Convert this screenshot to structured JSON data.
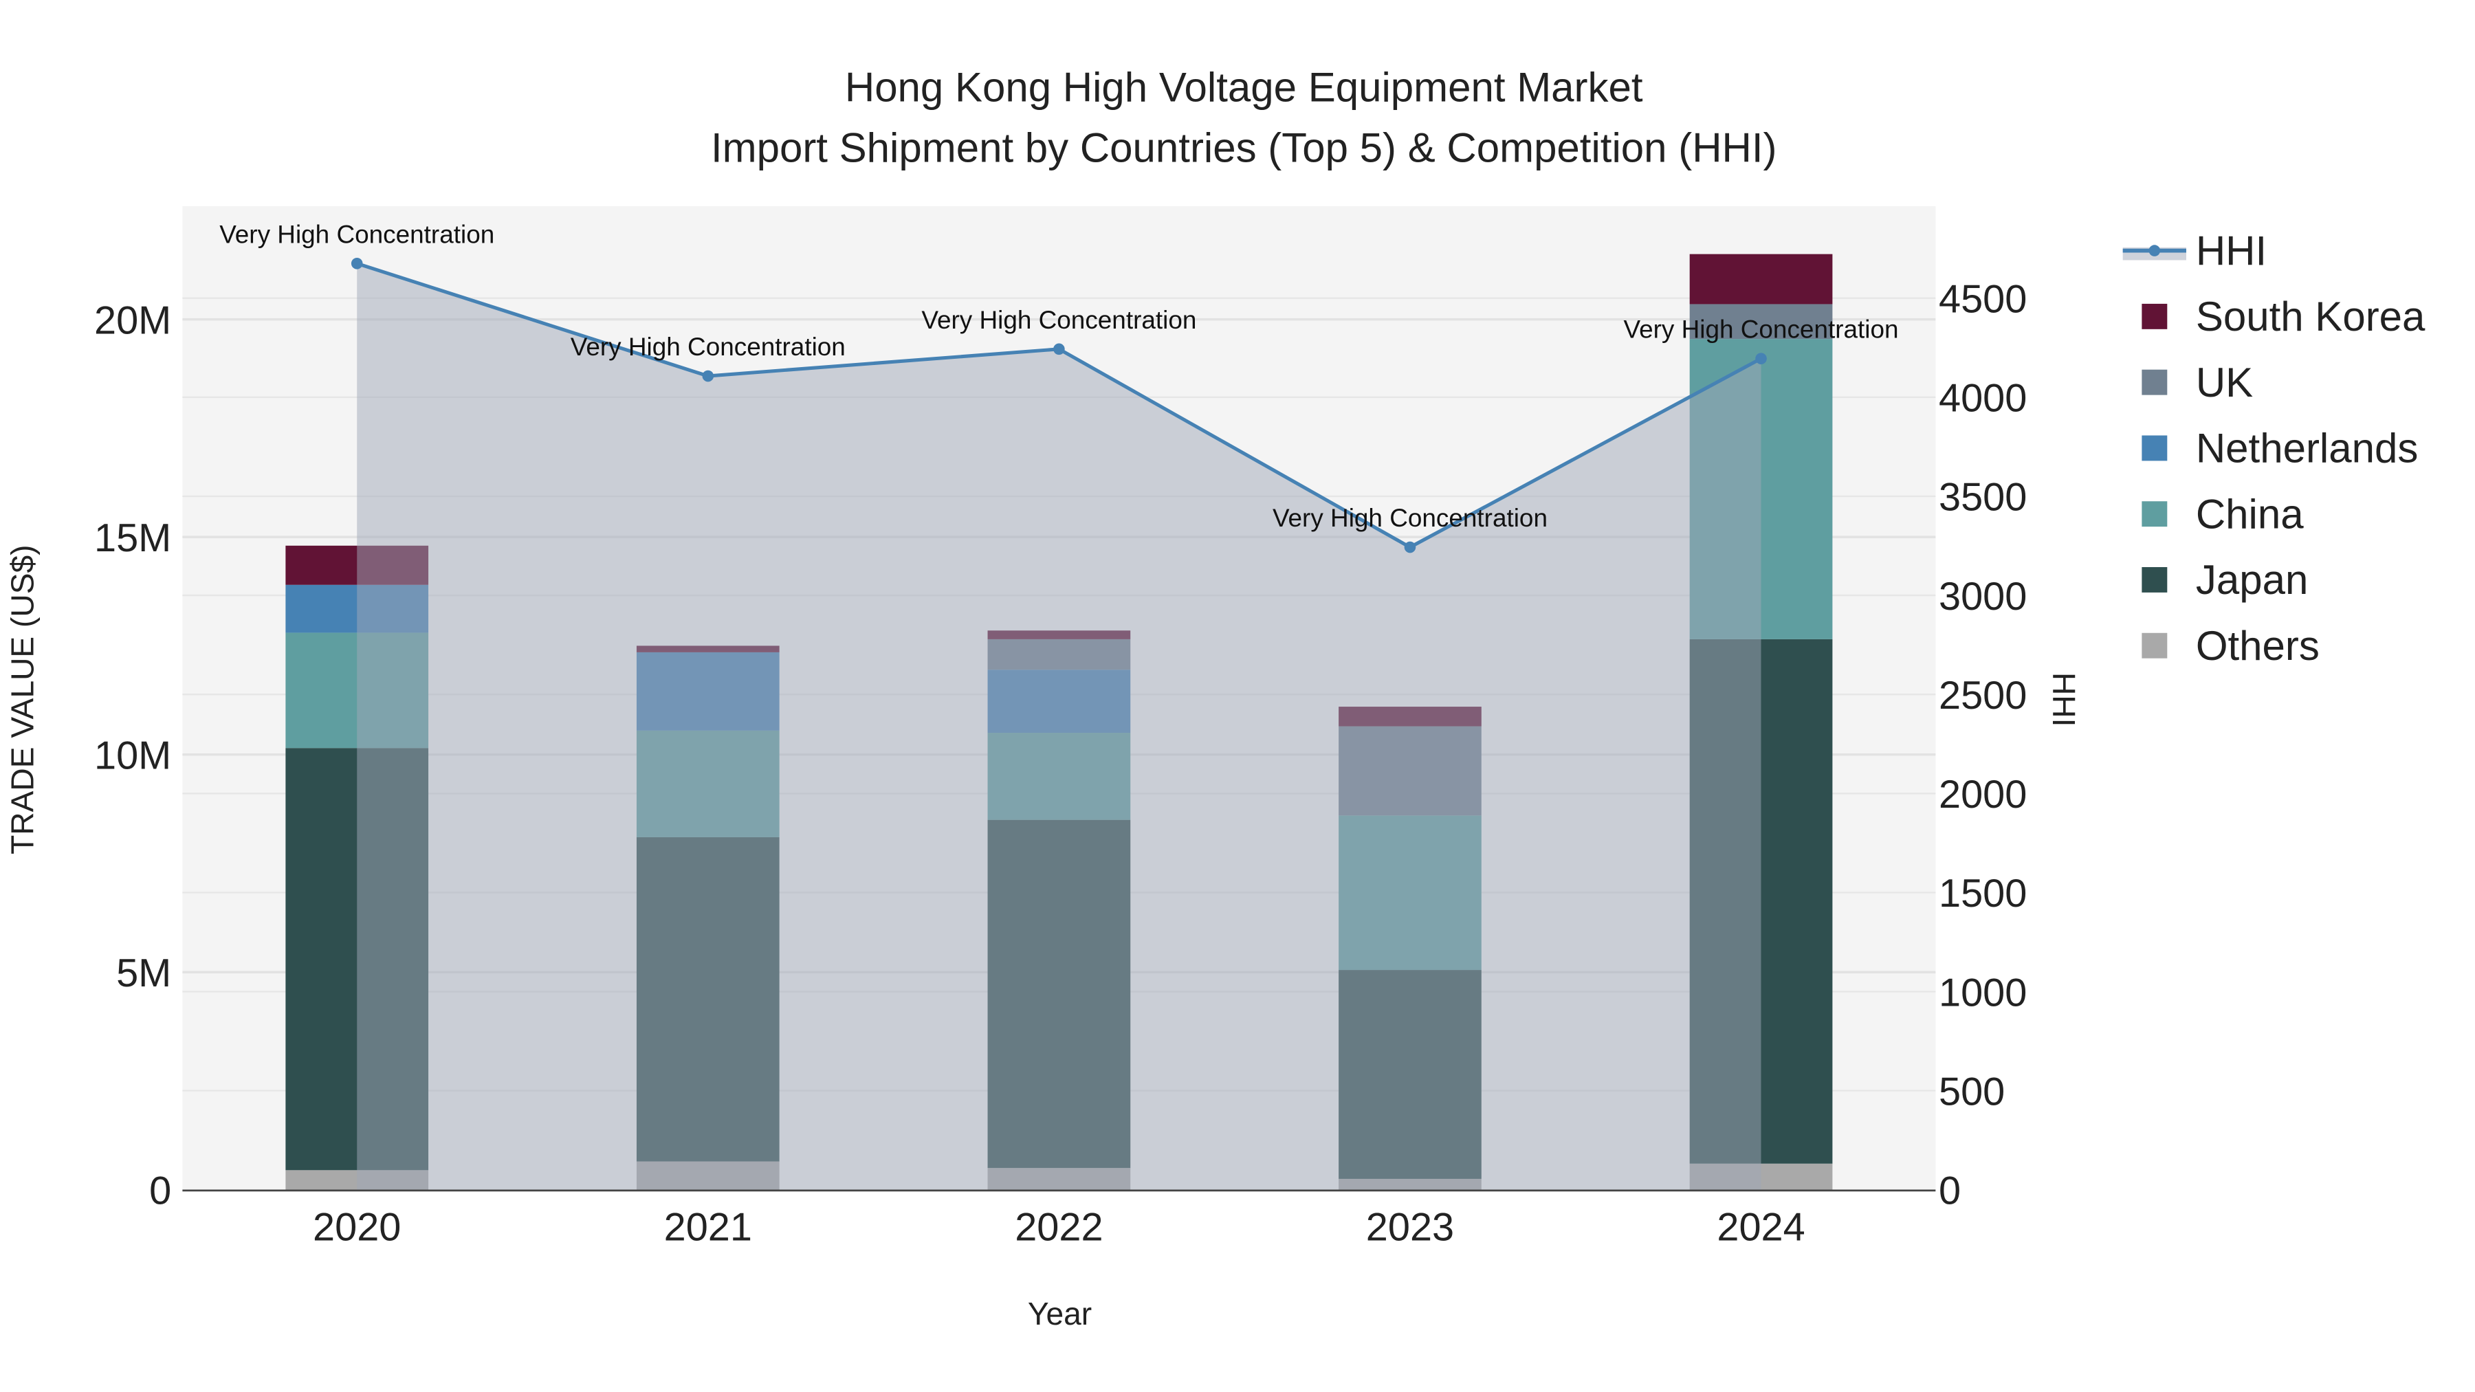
{
  "chart_data": {
    "type": "bar",
    "title_line1": "Hong Kong High Voltage Equipment Market",
    "title_line2": "Import Shipment by Countries (Top 5) & Competition (HHI)",
    "xlabel": "Year",
    "ylabel": "TRADE VALUE (US$)",
    "y2label": "HHI",
    "categories": [
      "2020",
      "2021",
      "2022",
      "2023",
      "2024"
    ],
    "ylim": [
      0,
      22600000
    ],
    "y2lim": [
      0,
      4964
    ],
    "yticks": [
      {
        "value": 0,
        "label": "0"
      },
      {
        "value": 5000000,
        "label": "5M"
      },
      {
        "value": 10000000,
        "label": "10M"
      },
      {
        "value": 15000000,
        "label": "15M"
      },
      {
        "value": 20000000,
        "label": "20M"
      }
    ],
    "y2ticks": [
      0,
      500,
      1000,
      1500,
      2000,
      2500,
      3000,
      3500,
      4000,
      4500
    ],
    "grid": true,
    "legend_position": "right",
    "series": [
      {
        "name": "Others",
        "color": "#a9a9a9",
        "values": [
          450000,
          650000,
          500000,
          250000,
          600000
        ]
      },
      {
        "name": "Japan",
        "color": "#2f4f4f",
        "values": [
          9700000,
          7450000,
          8000000,
          4800000,
          12050000
        ]
      },
      {
        "name": "China",
        "color": "#5f9ea0",
        "values": [
          2650000,
          2450000,
          2000000,
          3550000,
          6900000
        ]
      },
      {
        "name": "Netherlands",
        "color": "#4682b4",
        "values": [
          1100000,
          1800000,
          1450000,
          0,
          0
        ]
      },
      {
        "name": "UK",
        "color": "#708090",
        "values": [
          0,
          0,
          700000,
          2050000,
          800000
        ]
      },
      {
        "name": "South Korea",
        "color": "#611335",
        "values": [
          900000,
          150000,
          200000,
          450000,
          1150000
        ]
      }
    ],
    "hhi": {
      "name": "HHI",
      "color": "#4682b4",
      "values": [
        4675,
        4107,
        4243,
        3243,
        4195
      ],
      "annotations": [
        "Very High Concentration",
        "Very High Concentration",
        "Very High Concentration",
        "Very High Concentration",
        "Very High Concentration"
      ]
    },
    "legend_order": [
      "HHI",
      "South Korea",
      "UK",
      "Netherlands",
      "China",
      "Japan",
      "Others"
    ]
  }
}
